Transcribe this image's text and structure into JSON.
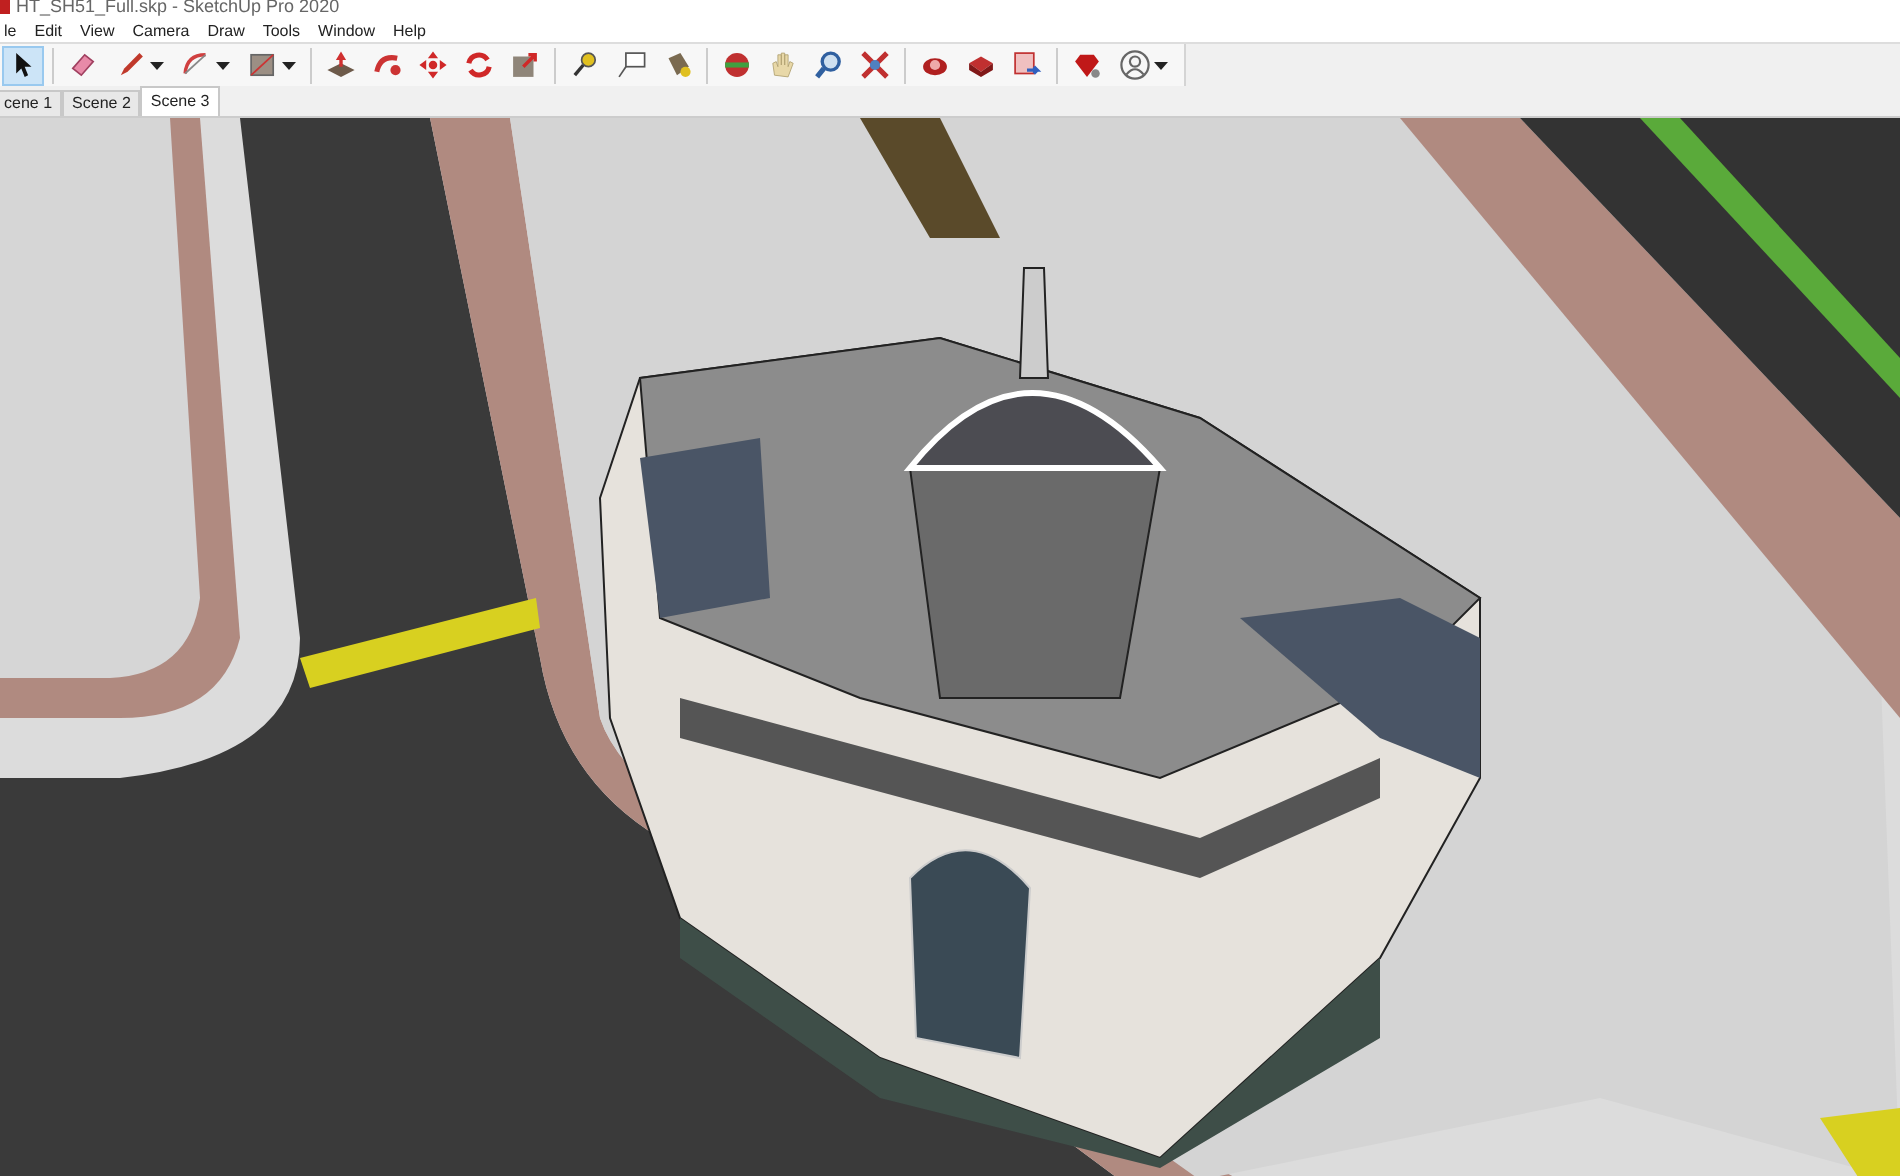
{
  "window": {
    "title": "HT_SH51_Full.skp - SketchUp Pro 2020"
  },
  "menu": [
    "le",
    "Edit",
    "View",
    "Camera",
    "Draw",
    "Tools",
    "Window",
    "Help"
  ],
  "toolbar": [
    {
      "selected": true
    },
    {
      "selected": false
    },
    {
      "selected": false
    },
    {
      "selected": false
    },
    {
      "selected": false
    },
    {
      "selected": false
    },
    {
      "selected": false
    },
    {
      "selected": false
    },
    {
      "selected": false
    },
    {
      "selected": false
    },
    {
      "selected": false
    },
    {
      "selected": false
    },
    {
      "selected": false
    },
    {
      "selected": false
    },
    {
      "selected": false
    },
    {
      "selected": false
    },
    {
      "selected": false
    },
    {
      "selected": false
    },
    {
      "selected": false
    },
    {
      "selected": false
    },
    {
      "selected": false
    },
    {
      "selected": false
    }
  ],
  "scenes": [
    {
      "label": "cene 1",
      "selected": false
    },
    {
      "label": "Scene 2",
      "selected": false
    },
    {
      "label": "Scene 3",
      "selected": true
    }
  ]
}
